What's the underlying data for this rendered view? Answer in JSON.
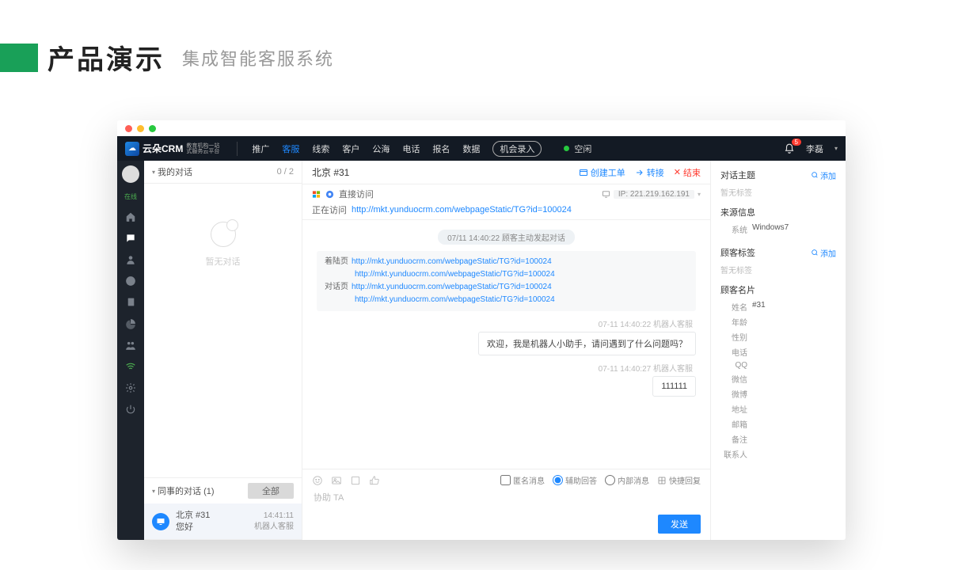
{
  "slide": {
    "title": "产品演示",
    "subtitle": "集成智能客服系统"
  },
  "topnav": {
    "logoText": "云朵CRM",
    "logoSub1": "教育机构一站",
    "logoSub2": "式服务云平台",
    "items": [
      "推广",
      "客服",
      "线索",
      "客户",
      "公海",
      "电话",
      "报名",
      "数据"
    ],
    "activeIndex": 1,
    "recordBtn": "机会录入",
    "statusText": "空闲",
    "badge": "5",
    "user": "李磊"
  },
  "convlist": {
    "myTitle": "我的对话",
    "myCount": "0 / 2",
    "emptyText": "暂无对话",
    "peerTitle": "同事的对话  (1)",
    "allBtn": "全部",
    "peer": {
      "name": "北京 #31",
      "msg": "您好",
      "time": "14:41:11",
      "origin": "机器人客服"
    }
  },
  "chat": {
    "title": "北京 #31",
    "actions": {
      "ticket": "创建工单",
      "transfer": "转接",
      "end": "结束"
    },
    "direct": "直接访问",
    "visitingLabel": "正在访问",
    "visitingUrl": "http://mkt.yunduocrm.com/webpageStatic/TG?id=100024",
    "ipLabel": "IP:",
    "ip": "221.219.162.191",
    "sysPill": "07/11 14:40:22  顾客主动发起对话",
    "linkblock": {
      "landLabel": "着陆页",
      "chatLabel": "对话页",
      "url": "http://mkt.yunduocrm.com/webpageStatic/TG?id=100024"
    },
    "ts1": "07-11 14:40:22  机器人客服",
    "bubble1": "欢迎，我是机器人小助手，请问遇到了什么问题吗？",
    "ts2": "07-11 14:40:27  机器人客服",
    "bubble2": "111111"
  },
  "composer": {
    "optAnon": "匿名消息",
    "optAssist": "辅助回答",
    "optInternal": "内部消息",
    "optQuick": "快捷回复",
    "placeholder": "协助 TA",
    "send": "发送"
  },
  "rightcol": {
    "topicTitle": "对话主题",
    "addText": "添加",
    "topicEmpty": "暂无标签",
    "srcTitle": "来源信息",
    "srcSysLabel": "系统",
    "srcSysVal": "Windows7",
    "tagTitle": "顾客标签",
    "tagEmpty": "暂无标签",
    "cardTitle": "顾客名片",
    "cardNameLabel": "姓名",
    "cardNameVal": "#31",
    "labels": [
      "年龄",
      "性别",
      "电话",
      "QQ",
      "微信",
      "微博",
      "地址",
      "邮箱",
      "备注",
      "联系人"
    ]
  }
}
